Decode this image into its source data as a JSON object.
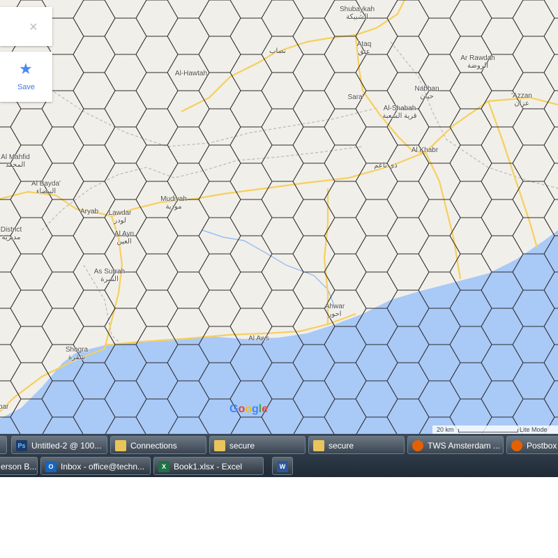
{
  "map": {
    "colors": {
      "land": "#f1efe9",
      "sea": "#a9c9f7",
      "road": "#f6cf5d",
      "grid": "#2b2b2b",
      "border": "#b0b0b0",
      "river": "#8ab4f8"
    },
    "places": [
      {
        "name": "Shubaykah",
        "ar": "الشبيكة"
      },
      {
        "name": "",
        "ar": "نصاب"
      },
      {
        "name": "Ataq",
        "ar": "عتق"
      },
      {
        "name": "Ar Rawdah",
        "ar": "الروضة"
      },
      {
        "name": "Al-Hawtah",
        "ar": ""
      },
      {
        "name": "Sara'",
        "ar": ""
      },
      {
        "name": "Nabban",
        "ar": "حبان"
      },
      {
        "name": "'Azzan",
        "ar": "عزان"
      },
      {
        "name": "Al-Shabah",
        "ar": "قرية الشعبة"
      },
      {
        "name": "Al Khabr",
        "ar": ""
      },
      {
        "name": "",
        "ar": "ذي ناعم"
      },
      {
        "name": "Al Mahfid",
        "ar": "المحفد"
      },
      {
        "name": "Al Bayda'",
        "ar": "البيضاء"
      },
      {
        "name": "Mudiyah",
        "ar": "مودية"
      },
      {
        "name": "Aryab",
        "ar": ""
      },
      {
        "name": "Lawdar",
        "ar": "لودر"
      },
      {
        "name": "Al Ayn",
        "ar": "العين"
      },
      {
        "name": "District",
        "ar": "مديرية"
      },
      {
        "name": "As Surrah",
        "ar": "السرة"
      },
      {
        "name": "Ahwar",
        "ar": "احور"
      },
      {
        "name": "Al Aws",
        "ar": ""
      },
      {
        "name": "Shogra",
        "ar": "شقرة"
      },
      {
        "name": "ibar",
        "ar": ""
      }
    ]
  },
  "panel": {
    "save_label": "Save",
    "close_icon": "close-icon",
    "save_icon": "star-icon"
  },
  "attribution": {
    "logo": "Google",
    "scale_label": "20 km",
    "mode_label": "Lite Mode"
  },
  "taskbar": {
    "row1": [
      "Untitled-2 @ 100...",
      "Connections",
      "secure",
      "secure",
      "TWS Amsterdam ...",
      "Postbox"
    ],
    "row2": [
      "erson B...",
      "Inbox - office@techn...",
      "Book1.xlsx - Excel",
      ""
    ]
  }
}
